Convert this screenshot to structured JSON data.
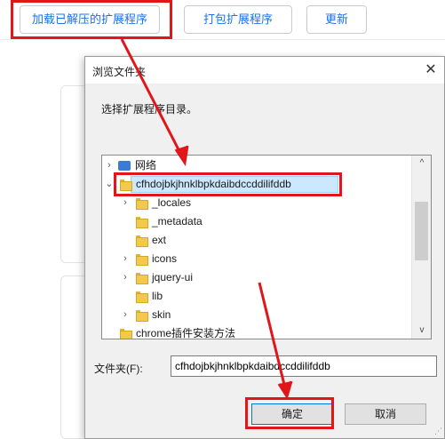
{
  "toolbar": {
    "load_label": "加载已解压的扩展程序",
    "pack_label": "打包扩展程序",
    "update_label": "更新"
  },
  "dialog": {
    "title": "浏览文件夹",
    "close_symbol": "✕",
    "prompt": "选择扩展程序目录。",
    "tree": [
      {
        "label": "网络",
        "chevron": "›",
        "icon": "network-icon"
      },
      {
        "label": "cfhdojbkjhnklbpkdaibdccddilifddb",
        "chevron": "⌄",
        "icon": "folder-icon",
        "selected": true
      },
      {
        "label": "_locales",
        "chevron": "›",
        "icon": "folder-icon"
      },
      {
        "label": "_metadata",
        "chevron": "",
        "icon": "folder-icon"
      },
      {
        "label": "ext",
        "chevron": "",
        "icon": "folder-icon"
      },
      {
        "label": "icons",
        "chevron": "›",
        "icon": "folder-icon"
      },
      {
        "label": "jquery-ui",
        "chevron": "›",
        "icon": "folder-icon"
      },
      {
        "label": "lib",
        "chevron": "",
        "icon": "folder-icon"
      },
      {
        "label": "skin",
        "chevron": "›",
        "icon": "folder-icon"
      },
      {
        "label": "chrome插件安装方法",
        "chevron": "",
        "icon": "folder-icon"
      }
    ],
    "scroll_up": "^",
    "scroll_down": "v",
    "folder_label": "文件夹(F):",
    "folder_value": "cfhdojbkjhnklbpkdaibdccddilifddb",
    "ok_label": "确定",
    "cancel_label": "取消"
  },
  "colors": {
    "highlight": "#e0161b",
    "accent": "#1a73e8",
    "selection": "#cce8ff"
  }
}
